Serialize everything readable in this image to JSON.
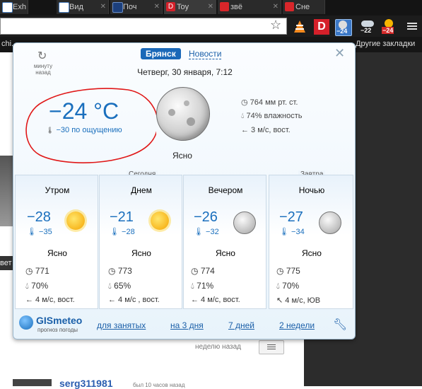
{
  "browser": {
    "tabs": [
      {
        "title": "Exh",
        "icon": "vk-icon"
      },
      {
        "title": "Вид",
        "icon": "vk-icon"
      },
      {
        "title": "Поч",
        "icon": "mail-icon"
      },
      {
        "title": "Toy",
        "icon": "d-icon"
      },
      {
        "title": "звё",
        "icon": "youtube-icon"
      },
      {
        "title": "Сне",
        "icon": "youtube-icon"
      }
    ],
    "ext_badges": [
      "−24",
      "−22",
      "−24"
    ],
    "bookmarks_left": "chi..",
    "bookmarks_right": "Другие закладки"
  },
  "popup": {
    "refresh_label": "минуту назад",
    "city": "Брянск",
    "news": "Новости",
    "date": "Четверг, 30 января, 7:12",
    "current": {
      "temp": "−24 °C",
      "feels": "−30 по ощущению",
      "condition": "Ясно",
      "pressure": "764 мм рт. ст.",
      "humidity": "74% влажность",
      "wind": "← 3 м/с, вост."
    },
    "today_label": "Сегодня",
    "tomorrow_label": "Завтра",
    "periods": [
      {
        "name": "Утром",
        "temp": "−28",
        "feels": "−35",
        "cond": "Ясно",
        "pressure": "771",
        "humidity": "70%",
        "wind": "← 4 м/с, вост.",
        "icon": "sun"
      },
      {
        "name": "Днем",
        "temp": "−21",
        "feels": "−28",
        "cond": "Ясно",
        "pressure": "773",
        "humidity": "65%",
        "wind": "← 4 м/с , вост.",
        "icon": "sun"
      },
      {
        "name": "Вечером",
        "temp": "−26",
        "feels": "−32",
        "cond": "Ясно",
        "pressure": "774",
        "humidity": "71%",
        "wind": "← 4 м/с, вост.",
        "icon": "moon"
      },
      {
        "name": "Ночью",
        "temp": "−27",
        "feels": "−34",
        "cond": "Ясно",
        "pressure": "775",
        "humidity": "70%",
        "wind": "↖ 4 м/с, ЮВ",
        "icon": "moon"
      }
    ],
    "brand": "GISmeteo",
    "brand_sub": "прогноз погоды",
    "links": [
      "для занятых",
      "на 3 дня",
      "7 дней",
      "2 недели"
    ]
  },
  "page": {
    "left_text": "вет",
    "ago": "неделю назад",
    "user": "serg311981",
    "user_meta": "был 10 часов назад"
  }
}
